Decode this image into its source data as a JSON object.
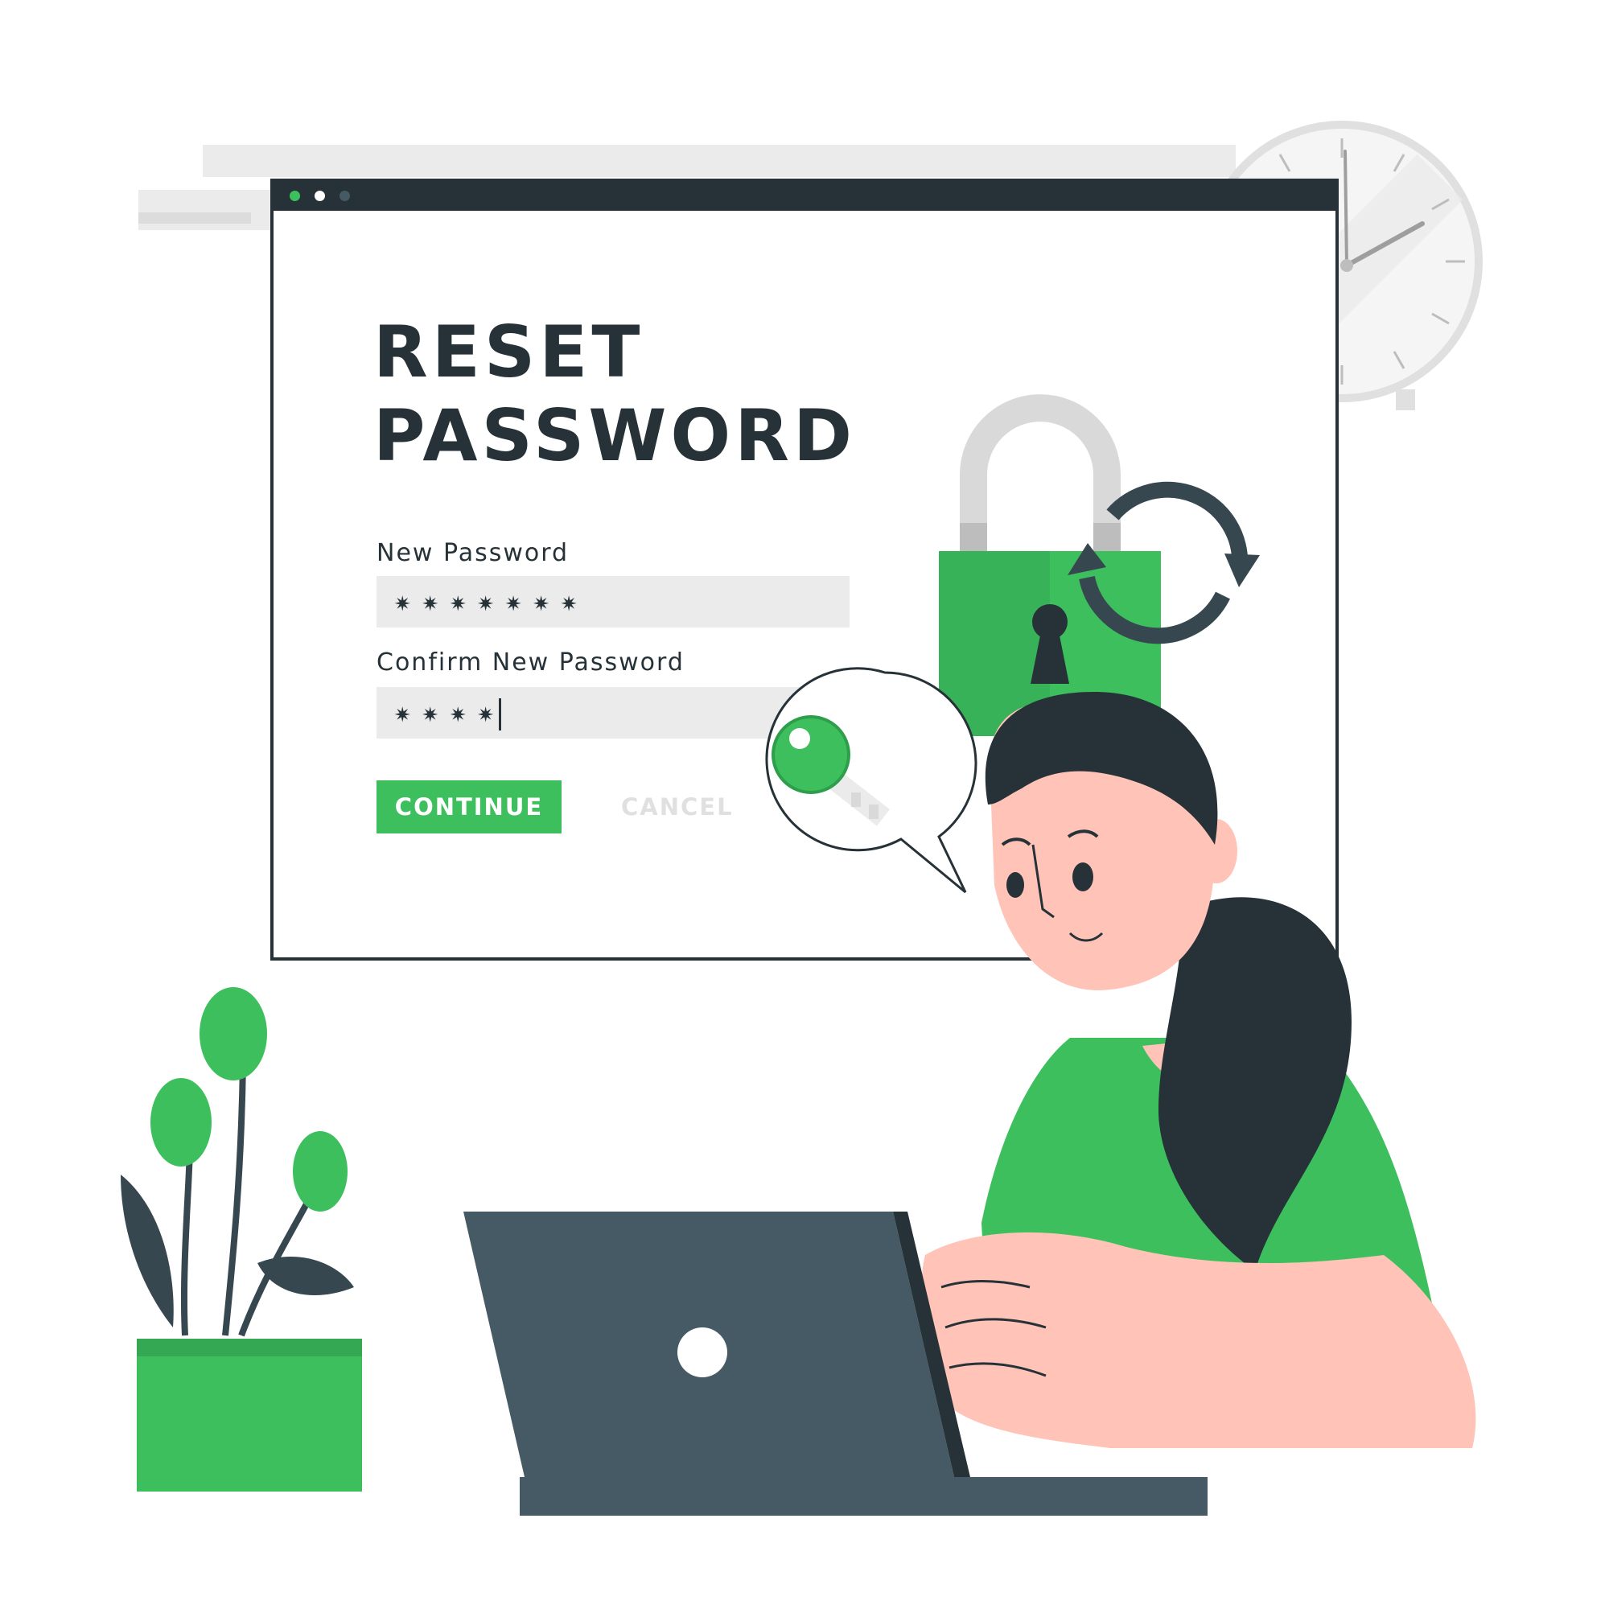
{
  "illustration": {
    "theme": "password-reset",
    "colors": {
      "accent": "#3dbf5e",
      "dark": "#263238",
      "laptop": "#455a64",
      "skin": "#ffc3b8",
      "light_gray": "#ebebeb"
    },
    "icons": [
      "padlock-icon",
      "refresh-arrows-icon",
      "key-icon",
      "clock-icon"
    ]
  },
  "window": {
    "controls": [
      "green-dot",
      "white-dot",
      "gray-dot"
    ]
  },
  "form": {
    "title": "RESET\nPASSWORD",
    "new_password": {
      "label": "New Password",
      "value": "✷✷✷✷✷✷✷"
    },
    "confirm_password": {
      "label": "Confirm New Password",
      "value": "✷✷✷✷"
    },
    "continue_label": "CONTINUE",
    "cancel_label": "CANCEL"
  }
}
